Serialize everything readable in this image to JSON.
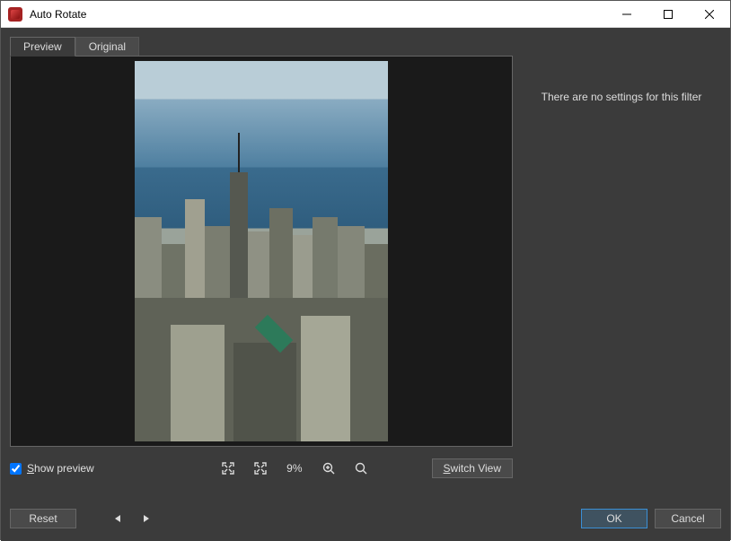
{
  "window": {
    "title": "Auto Rotate"
  },
  "tabs": {
    "preview": "Preview",
    "original": "Original"
  },
  "settings": {
    "empty_message": "There are no settings for this filter"
  },
  "controls": {
    "show_preview_label": "Show preview",
    "show_preview_checked": true,
    "zoom_percent": "9%",
    "switch_view_label": "Switch View"
  },
  "footer": {
    "reset_label": "Reset",
    "ok_label": "OK",
    "cancel_label": "Cancel"
  }
}
